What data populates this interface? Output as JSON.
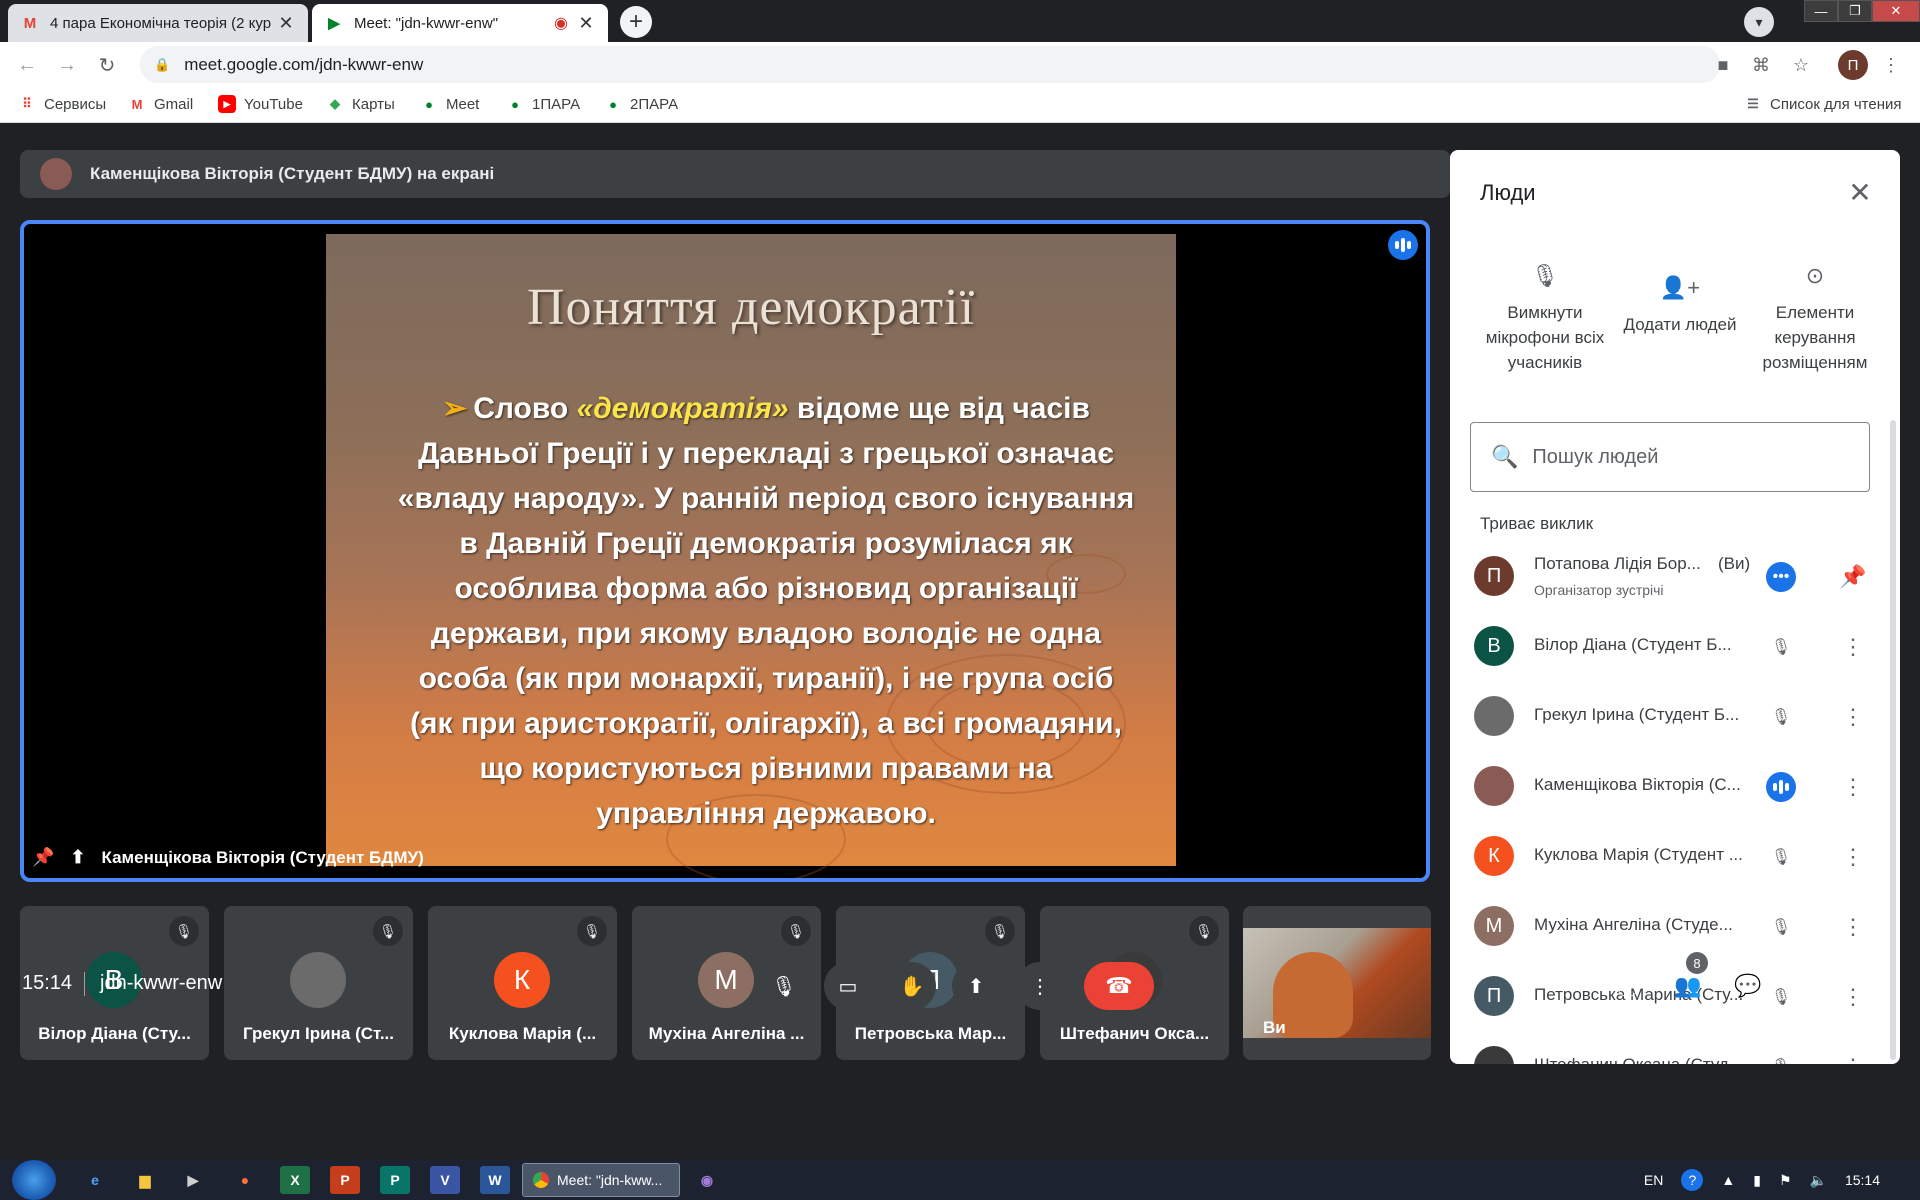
{
  "browser": {
    "tabs": [
      {
        "title": "4 пара Економічна теорія (2 кур",
        "favicon": "gmail-icon"
      },
      {
        "title": "Meet: \"jdn-kwwr-enw\"",
        "favicon": "meet-icon"
      }
    ],
    "url": "meet.google.com/jdn-kwwr-enw",
    "profile_initial": "П",
    "bookmarks": [
      {
        "label": "Сервисы"
      },
      {
        "label": "Gmail"
      },
      {
        "label": "YouTube"
      },
      {
        "label": "Карты"
      },
      {
        "label": "Meet"
      },
      {
        "label": "1ПАРА"
      },
      {
        "label": "2ПАРА"
      }
    ],
    "reading_list": "Список для чтения"
  },
  "meet": {
    "presenting_banner": "Каменщікова Вікторія (Студент БДМУ) на екрані",
    "main_tile_label": "Каменщікова Вікторія (Студент БДМУ)",
    "slide": {
      "title": "Поняття демократії",
      "bullet_arrow": "➢",
      "lead": "Слово ",
      "keyword": "«демократія»",
      "body": " відоме ще від часів Давньої Греції і у перекладі з грецької означає «владу народу». У ранній період свого існування в Давній Греції демократія розумілася як особлива форма або різновид організації держави, при якому владою володіє не одна особа (як при монархії, тиранії), і не група осіб (як при аристократії, олігархії), а всі громадяни, що користуються рівними правами на управління державою."
    },
    "thumbnails": [
      {
        "initial": "В",
        "name": "Вілор Діана (Сту...",
        "color": "#0b5345"
      },
      {
        "initial": "",
        "name": "Грекул Ірина (Ст...",
        "color": "#6b6b6b"
      },
      {
        "initial": "К",
        "name": "Куклова Марія (...",
        "color": "#f4511e"
      },
      {
        "initial": "М",
        "name": "Мухіна Ангеліна ...",
        "color": "#8d6e63"
      },
      {
        "initial": "П",
        "name": "Петровська Мар...",
        "color": "#455a64"
      },
      {
        "initial": "",
        "name": "Штефанич Окса...",
        "color": "#3a3a3a"
      }
    ],
    "self_label": "Ви",
    "time": "15:14",
    "meeting_code": "jdn-kwwr-enw",
    "participant_count": "8"
  },
  "people": {
    "title": "Люди",
    "actions": [
      {
        "label": "Вимкнути мікрофони всіх учасників",
        "icon": "mic-off-icon"
      },
      {
        "label": "Додати людей",
        "icon": "add-person-icon"
      },
      {
        "label": "Елементи керування розміщенням",
        "icon": "toggle-icon"
      }
    ],
    "search_placeholder": "Пошук людей",
    "section": "Триває виклик",
    "list": [
      {
        "initial": "П",
        "name": "Потапова Лідія Бор...",
        "you": "(Ви)",
        "sub": "Організатор зустрічі",
        "color": "#6d3b2e"
      },
      {
        "initial": "В",
        "name": "Вілор Діана (Студент Б...",
        "color": "#0b5345"
      },
      {
        "initial": "",
        "name": "Грекул Ірина (Студент Б...",
        "color": "#6b6b6b"
      },
      {
        "initial": "",
        "name": "Каменщікова Вікторія (С...",
        "color": "#8a5a54"
      },
      {
        "initial": "К",
        "name": "Куклова Марія (Студент ...",
        "color": "#f4511e"
      },
      {
        "initial": "М",
        "name": "Мухіна Ангеліна (Студе...",
        "color": "#8d6e63"
      },
      {
        "initial": "П",
        "name": "Петровська Марина (Сту...",
        "color": "#455a64"
      },
      {
        "initial": "",
        "name": "Штефанич Оксана (Студ...",
        "color": "#3a3a3a"
      }
    ]
  },
  "taskbar": {
    "chrome_label": "Meet: \"jdn-kww...",
    "lang": "EN",
    "time": "15:14"
  }
}
